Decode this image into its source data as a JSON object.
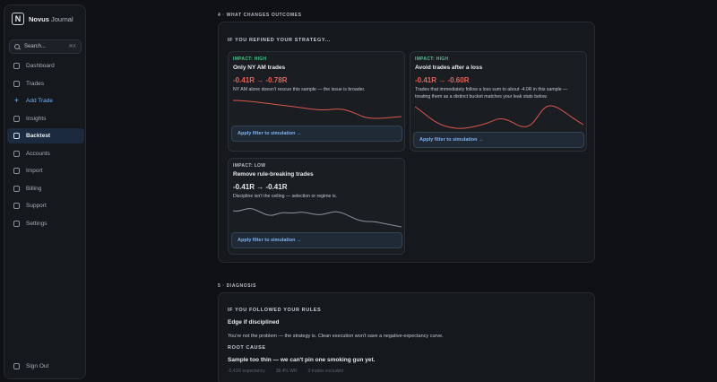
{
  "brand": {
    "logo": "N",
    "name": "Novus",
    "name_sub": "Journal"
  },
  "search": {
    "label": "Search...",
    "shortcut": "⌘K"
  },
  "nav": [
    {
      "label": "Dashboard",
      "icon": "grid-icon"
    },
    {
      "label": "Trades",
      "icon": "list-icon"
    },
    {
      "label": "Add Trade",
      "icon": "plus-icon"
    },
    {
      "label": "Insights",
      "icon": "chart-icon"
    },
    {
      "label": "Backtest",
      "icon": "flask-icon",
      "active": true
    },
    {
      "label": "Accounts",
      "icon": "wallet-icon"
    },
    {
      "label": "Import",
      "icon": "import-icon"
    },
    {
      "label": "Billing",
      "icon": "card-icon"
    },
    {
      "label": "Support",
      "icon": "help-icon"
    },
    {
      "label": "Settings",
      "icon": "gear-icon"
    }
  ],
  "signout": "Sign Out",
  "section4": {
    "label": "4 · WHAT CHANGES OUTCOMES",
    "panel_title": "IF YOU REFINED YOUR STRATEGY...",
    "cards": [
      {
        "impact": "IMPACT: HIGH",
        "title": "Only NY AM trades",
        "range": "-0.41R → -0.78R",
        "desc": "NY AM alone doesn't rescue this sample — the issue is broader.",
        "button": "Apply filter to simulation →"
      },
      {
        "impact": "IMPACT: HIGH",
        "title": "Avoid trades after a loss",
        "range": "-0.41R → -0.60R",
        "desc": "Trades that immediately follow a loss sum to about -4.0R in this sample — treating them as a distinct bucket matches your leak stats below.",
        "button": "Apply filter to simulation →"
      },
      {
        "impact": "IMPACT: LOW",
        "title": "Remove rule-breaking trades",
        "range": "-0.41R → -0.41R",
        "desc": "Discipline isn't the ceiling — selection or regime is.",
        "button": "Apply filter to simulation →"
      }
    ]
  },
  "section5": {
    "label": "5 · DIAGNOSIS",
    "panel_title": "IF YOU FOLLOWED YOUR RULES",
    "headline": "Edge if disciplined",
    "text": "You're not the problem — the strategy is. Clean execution won't save a negative-expectancy curve.",
    "root_label": "ROOT CAUSE",
    "root_headline": "Sample too thin — we can't pin one smoking gun yet.",
    "stats": [
      "-0.41R expectancy",
      "38.4% WR",
      "0 trades excluded"
    ]
  },
  "colors": {
    "accent": "#7fb2f0",
    "negative": "#e2645a",
    "high": "#4cc38a"
  }
}
